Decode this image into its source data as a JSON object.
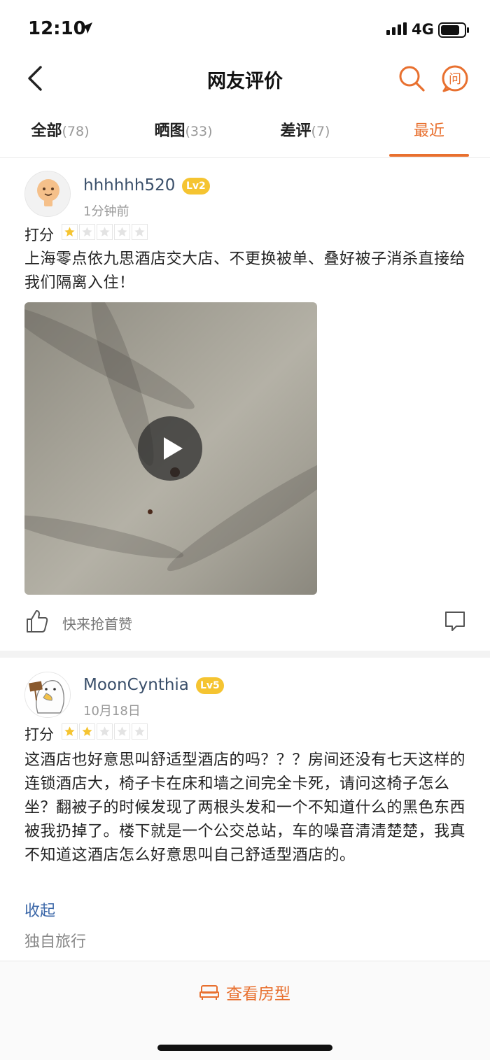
{
  "status_bar": {
    "time": "12:10",
    "network": "4G"
  },
  "nav": {
    "title": "网友评价",
    "ask_icon_label": "问"
  },
  "tabs": [
    {
      "label": "全部",
      "count": "(78)"
    },
    {
      "label": "晒图",
      "count": "(33)"
    },
    {
      "label": "差评",
      "count": "(7)"
    },
    {
      "label": "最近",
      "count": ""
    }
  ],
  "active_tab": "最近",
  "reviews": [
    {
      "username": "hhhhhh520",
      "level": "Lv2",
      "time": "1分钟前",
      "score_label": "打分",
      "rating": 1,
      "rating_max": 5,
      "text": "上海零点依九思酒店交大店、不更换被单、叠好被子消杀直接给我们隔离入住！",
      "like_text": "快来抢首赞"
    },
    {
      "username": "MoonCynthia",
      "level": "Lv5",
      "time": "10月18日",
      "score_label": "打分",
      "rating": 2,
      "rating_max": 5,
      "text": "这酒店也好意思叫舒适型酒店的吗？？？房间还没有七天这样的连锁酒店大，椅子卡在床和墙之间完全卡死，请问这椅子怎么坐？翻被子的时候发现了两根头发和一个不知道什么的黑色东西被我扔掉了。楼下就是一个公交总站，车的噪音清清楚楚，我真不知道这酒店怎么好意思叫自己舒适型酒店的。",
      "collapse_label": "收起",
      "trip_type": "独自旅行"
    }
  ],
  "bottom": {
    "room_button_label": "查看房型"
  },
  "colors": {
    "accent": "#e8702f",
    "star_fill": "#f5c431",
    "username": "#3a4f6a",
    "link": "#3b67a8"
  }
}
